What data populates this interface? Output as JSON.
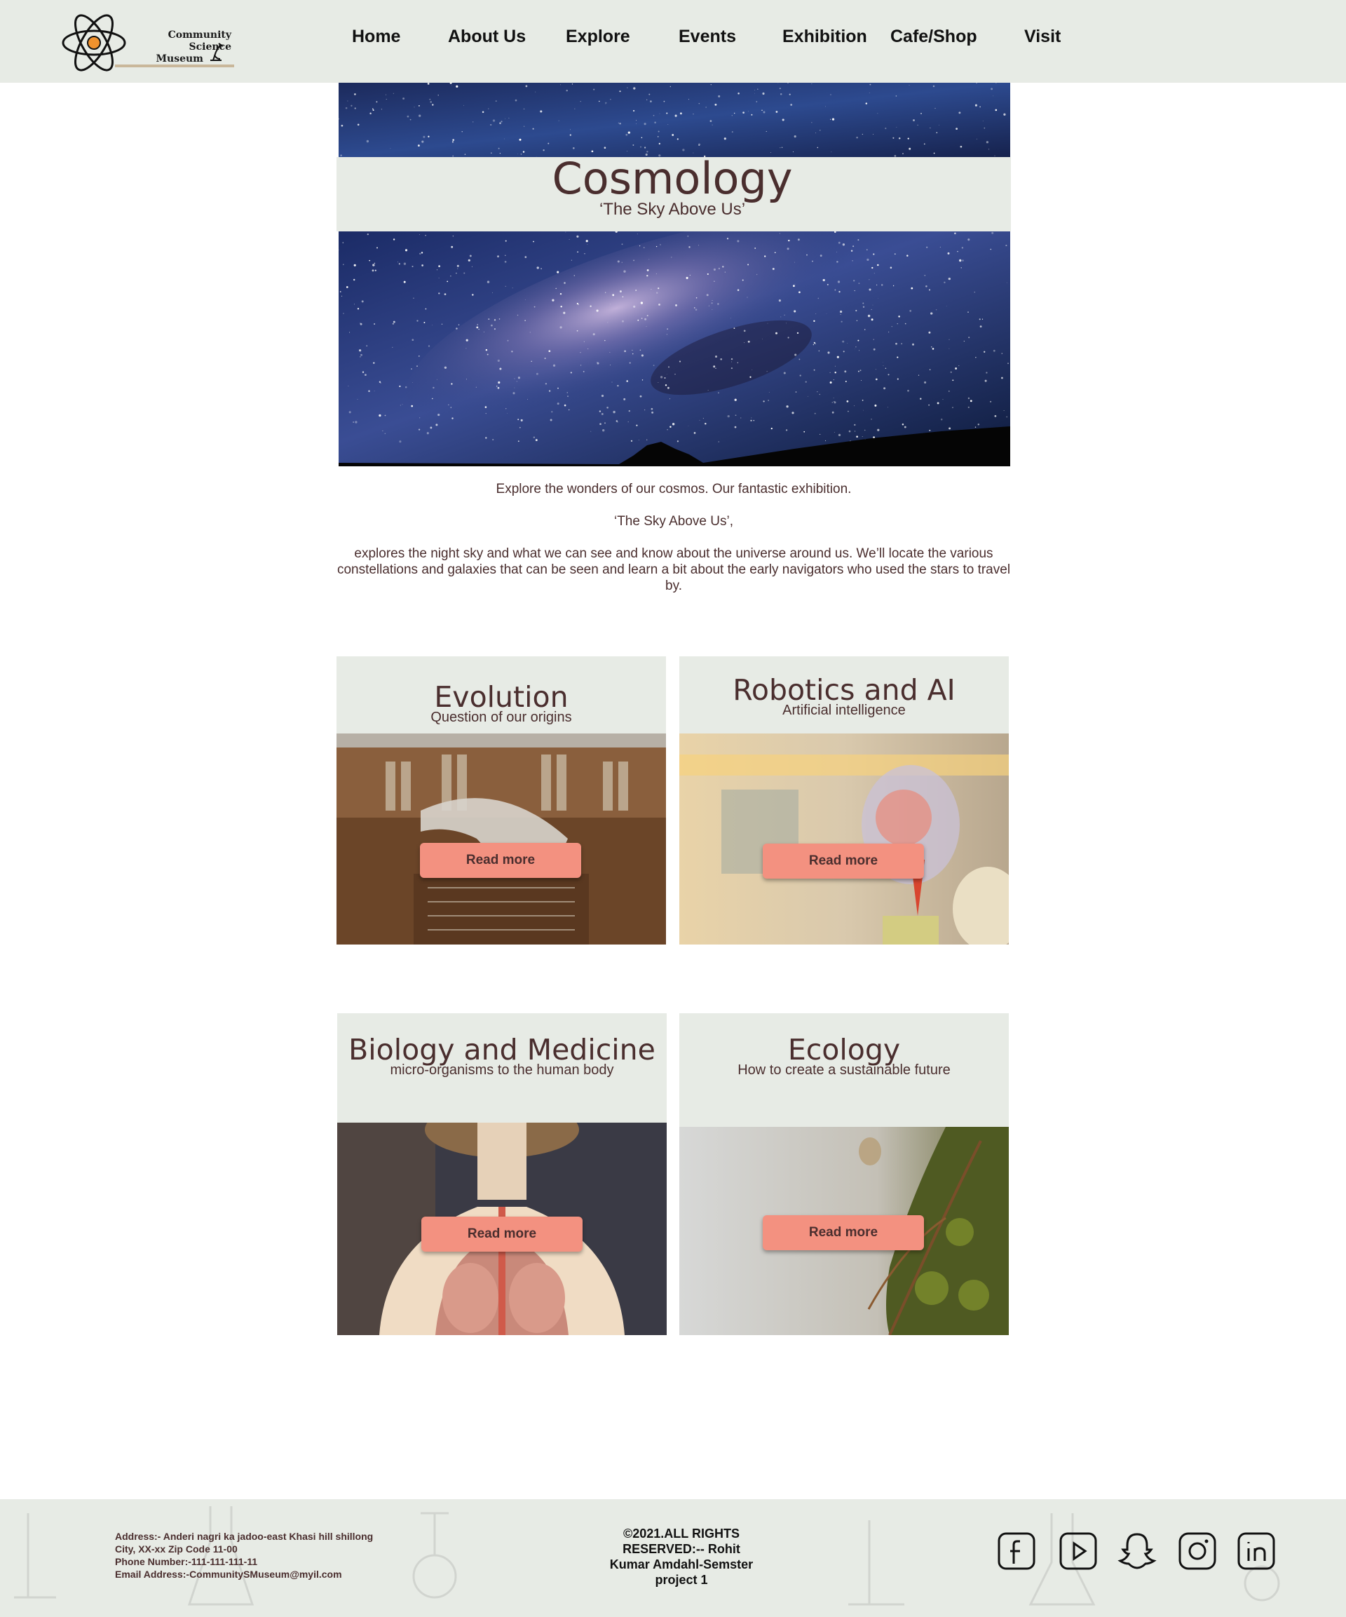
{
  "header": {
    "logo_line1": "Community Science",
    "logo_line2": "Museum",
    "nav": [
      {
        "label": "Home"
      },
      {
        "label": "About  Us"
      },
      {
        "label": "Explore"
      },
      {
        "label": "Events"
      },
      {
        "label": "Exhibition"
      },
      {
        "label": "Cafe/Shop"
      },
      {
        "label": "Visit"
      }
    ]
  },
  "hero": {
    "title": "Cosmology",
    "subtitle": "‘The Sky Above Us’"
  },
  "intro": {
    "line1": "Explore the wonders of our cosmos. Our fantastic exhibition.",
    "line2": "‘The Sky Above Us’,",
    "line3": "explores the night sky and what we can see and know about the universe around us. We’ll locate the various constellations and galaxies that can be seen and learn a bit about the early navigators who used the stars to travel by."
  },
  "cards": [
    {
      "title": "Evolution",
      "subtitle": "Question of our origins",
      "button": "Read more",
      "image": "natural-history-hall-whale-skeleton"
    },
    {
      "title": "Robotics and AI",
      "subtitle": "Artificial intelligence",
      "button": "Read more",
      "image": "transparent-head-model"
    },
    {
      "title": "Biology and Medicine",
      "subtitle": "micro-organisms to the human body",
      "button": "Read more",
      "image": "anatomical-torso-model"
    },
    {
      "title": "Ecology",
      "subtitle": "How to create a sustainable future",
      "button": "Read more",
      "image": "moss-and-water-droplet"
    }
  ],
  "footer": {
    "address": [
      "Address:- Anderi nagri ka jadoo-east Khasi hill shillong",
      "City, XX-xx Zip Code 11-00",
      "Phone Number:-111-111-111-11",
      "Email Address:-CommunitySMuseum@myil.com"
    ],
    "copyright": "©2021.ALL RIGHTS RESERVED:-- Rohit Kumar Amdahl-Semster project 1",
    "social": [
      "facebook-icon",
      "youtube-icon",
      "snapchat-icon",
      "instagram-icon",
      "linkedin-icon"
    ]
  },
  "colors": {
    "band": "#e7ebe5",
    "text": "#4a2e2e",
    "button": "#f39180"
  }
}
